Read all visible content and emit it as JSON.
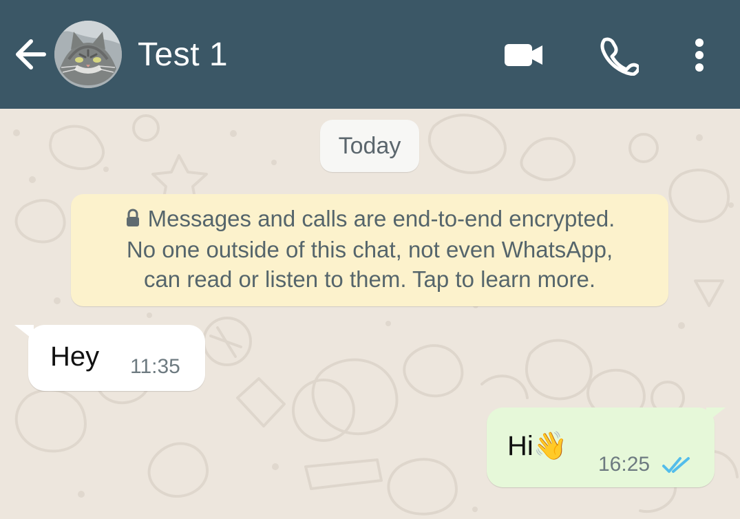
{
  "header": {
    "contact_name": "Test 1",
    "icons": {
      "back": "back-arrow-icon",
      "avatar": "contact-avatar",
      "video": "video-camera-icon",
      "call": "phone-icon",
      "menu": "more-options-icon"
    }
  },
  "chat": {
    "date_chip": "Today",
    "encryption_notice": {
      "line1": "Messages and calls are end-to-end encrypted.",
      "line2": "No one outside of this chat, not even WhatsApp,",
      "line3": "can read or listen to them. Tap to learn more."
    },
    "messages": [
      {
        "direction": "incoming",
        "text": "Hey",
        "time": "11:35"
      },
      {
        "direction": "outgoing",
        "text": "Hi👋",
        "time": "16:25",
        "status_icon": "double-check-icon"
      }
    ]
  },
  "colors": {
    "header": "#3b5766",
    "chat_background": "#ede6dd",
    "incoming_bubble": "#ffffff",
    "outgoing_bubble": "#e6f8d9",
    "encryption_notice": "#fcf2cc",
    "read_ticks": "#53bdeb"
  }
}
